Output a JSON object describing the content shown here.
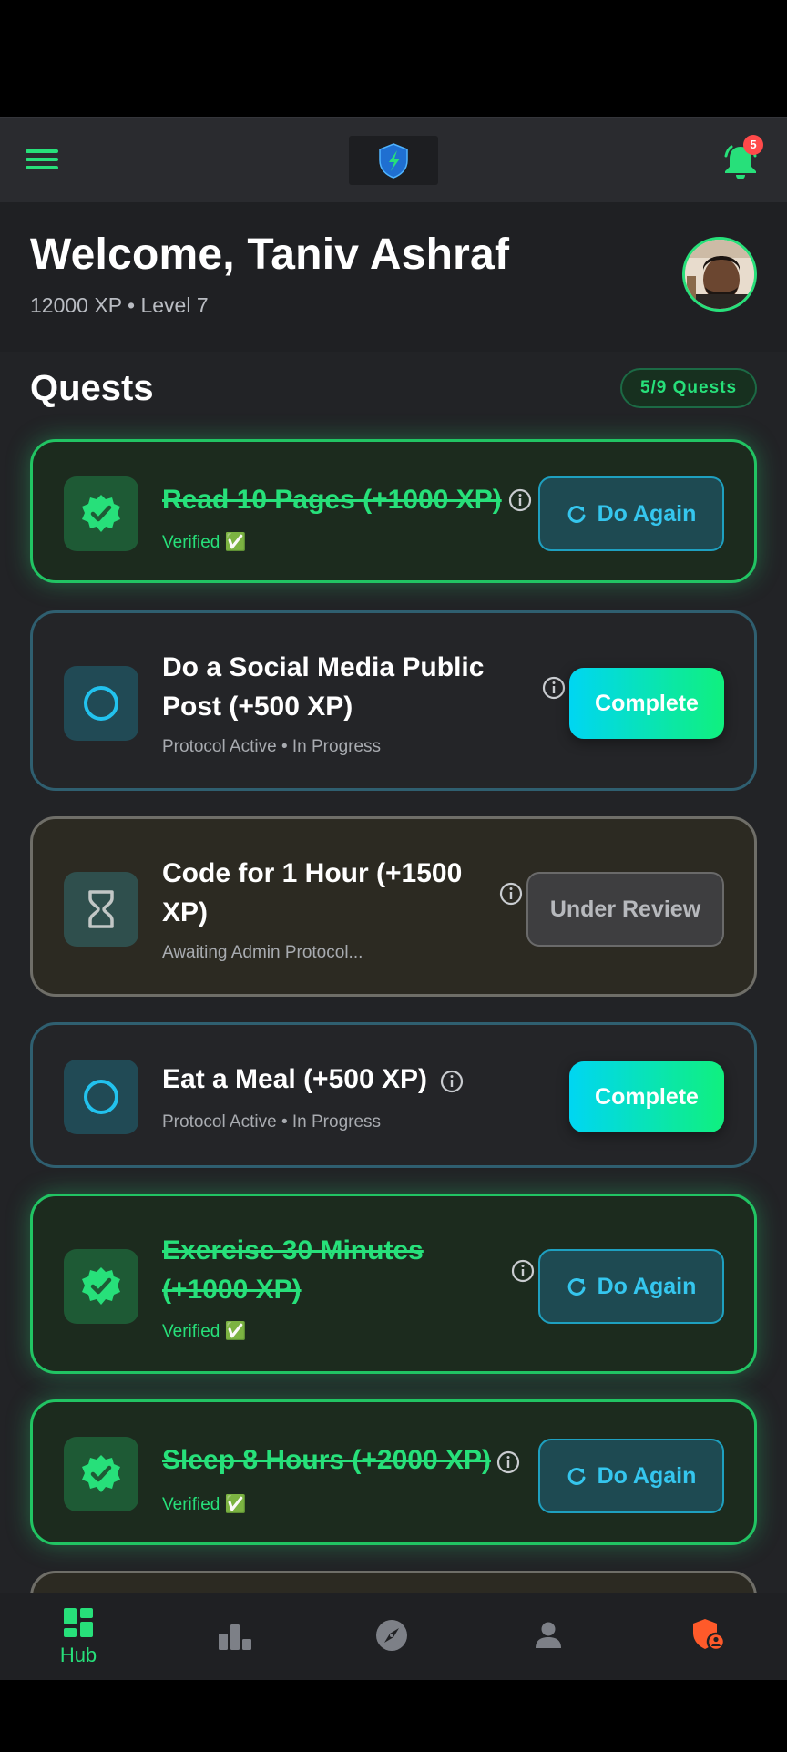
{
  "header": {
    "welcome": "Welcome, Taniv Ashraf",
    "xp_line": "12000 XP • Level 7",
    "notification_count": "5"
  },
  "quests": {
    "title": "Quests",
    "count_badge": "5/9 Quests",
    "items": [
      {
        "title": "Read 10 Pages (+1000 XP)",
        "status": "Verified ✅",
        "action": "Do Again",
        "state": "done"
      },
      {
        "title": "Do a Social Media Public Post (+500 XP)",
        "status": "Protocol Active • In Progress",
        "action": "Complete",
        "state": "active"
      },
      {
        "title": "Code for 1 Hour (+1500 XP)",
        "status": "Awaiting Admin Protocol...",
        "action": "Under Review",
        "state": "review"
      },
      {
        "title": "Eat a Meal (+500 XP)",
        "status": "Protocol Active • In Progress",
        "action": "Complete",
        "state": "active"
      },
      {
        "title": "Exercise 30 Minutes (+1000 XP)",
        "status": "Verified ✅",
        "action": "Do Again",
        "state": "done"
      },
      {
        "title": "Sleep 8 Hours (+2000 XP)",
        "status": "Verified ✅",
        "action": "Do Again",
        "state": "done"
      }
    ]
  },
  "nav": {
    "hub_label": "Hub",
    "active": "Hub"
  },
  "colors": {
    "accent_green": "#27e07a",
    "accent_cyan": "#35c6ee",
    "admin_orange": "#ff5a2a",
    "notification_red": "#ff4a4a"
  }
}
